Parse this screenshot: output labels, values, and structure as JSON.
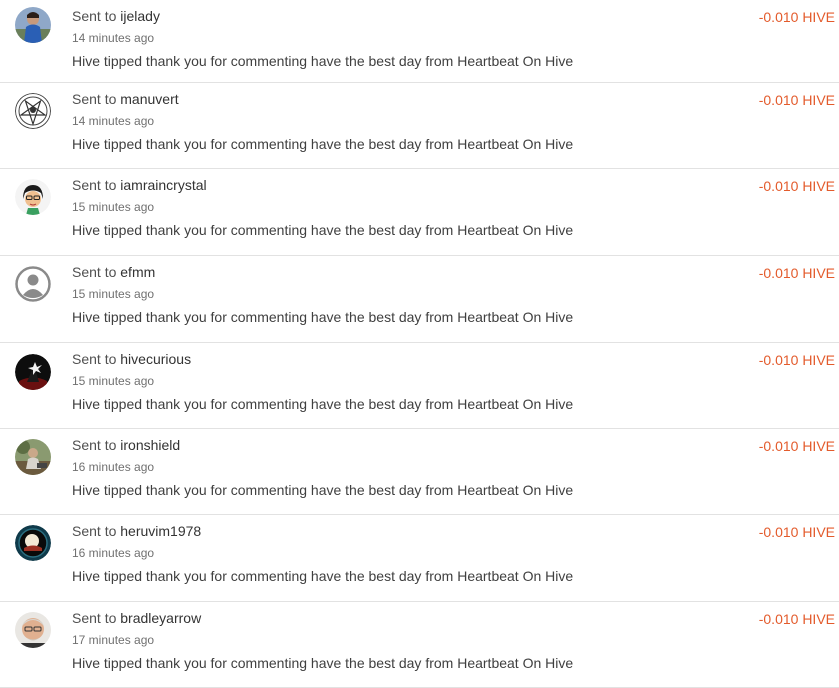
{
  "transfers": [
    {
      "prefix": "Sent to",
      "user": "ijelady",
      "time": "14 minutes ago",
      "memo": "Hive tipped thank you for commenting have the best day from Heartbeat On Hive",
      "amount": "-0.010 HIVE",
      "avatar": "user-photo-icon"
    },
    {
      "prefix": "Sent to",
      "user": "manuvert",
      "time": "14 minutes ago",
      "memo": "Hive tipped thank you for commenting have the best day from Heartbeat On Hive",
      "amount": "-0.010 HIVE",
      "avatar": "pentagram-icon"
    },
    {
      "prefix": "Sent to",
      "user": "iamraincrystal",
      "time": "15 minutes ago",
      "memo": "Hive tipped thank you for commenting have the best day from Heartbeat On Hive",
      "amount": "-0.010 HIVE",
      "avatar": "cartoon-face-icon"
    },
    {
      "prefix": "Sent to",
      "user": "efmm",
      "time": "15 minutes ago",
      "memo": "Hive tipped thank you for commenting have the best day from Heartbeat On Hive",
      "amount": "-0.010 HIVE",
      "avatar": "default-user-icon"
    },
    {
      "prefix": "Sent to",
      "user": "hivecurious",
      "time": "15 minutes ago",
      "memo": "Hive tipped thank you for commenting have the best day from Heartbeat On Hive",
      "amount": "-0.010 HIVE",
      "avatar": "dark-figure-icon"
    },
    {
      "prefix": "Sent to",
      "user": "ironshield",
      "time": "16 minutes ago",
      "memo": "Hive tipped thank you for commenting have the best day from Heartbeat On Hive",
      "amount": "-0.010 HIVE",
      "avatar": "outdoor-photo-icon"
    },
    {
      "prefix": "Sent to",
      "user": "heruvim1978",
      "time": "16 minutes ago",
      "memo": "Hive tipped thank you for commenting have the best day from Heartbeat On Hive",
      "amount": "-0.010 HIVE",
      "avatar": "moon-emblem-icon"
    },
    {
      "prefix": "Sent to",
      "user": "bradleyarrow",
      "time": "17 minutes ago",
      "memo": "Hive tipped thank you for commenting have the best day from Heartbeat On Hive",
      "amount": "-0.010 HIVE",
      "avatar": "portrait-photo-icon"
    }
  ],
  "colors": {
    "amount": "#e35b2c",
    "divider": "#e2e2e2"
  }
}
